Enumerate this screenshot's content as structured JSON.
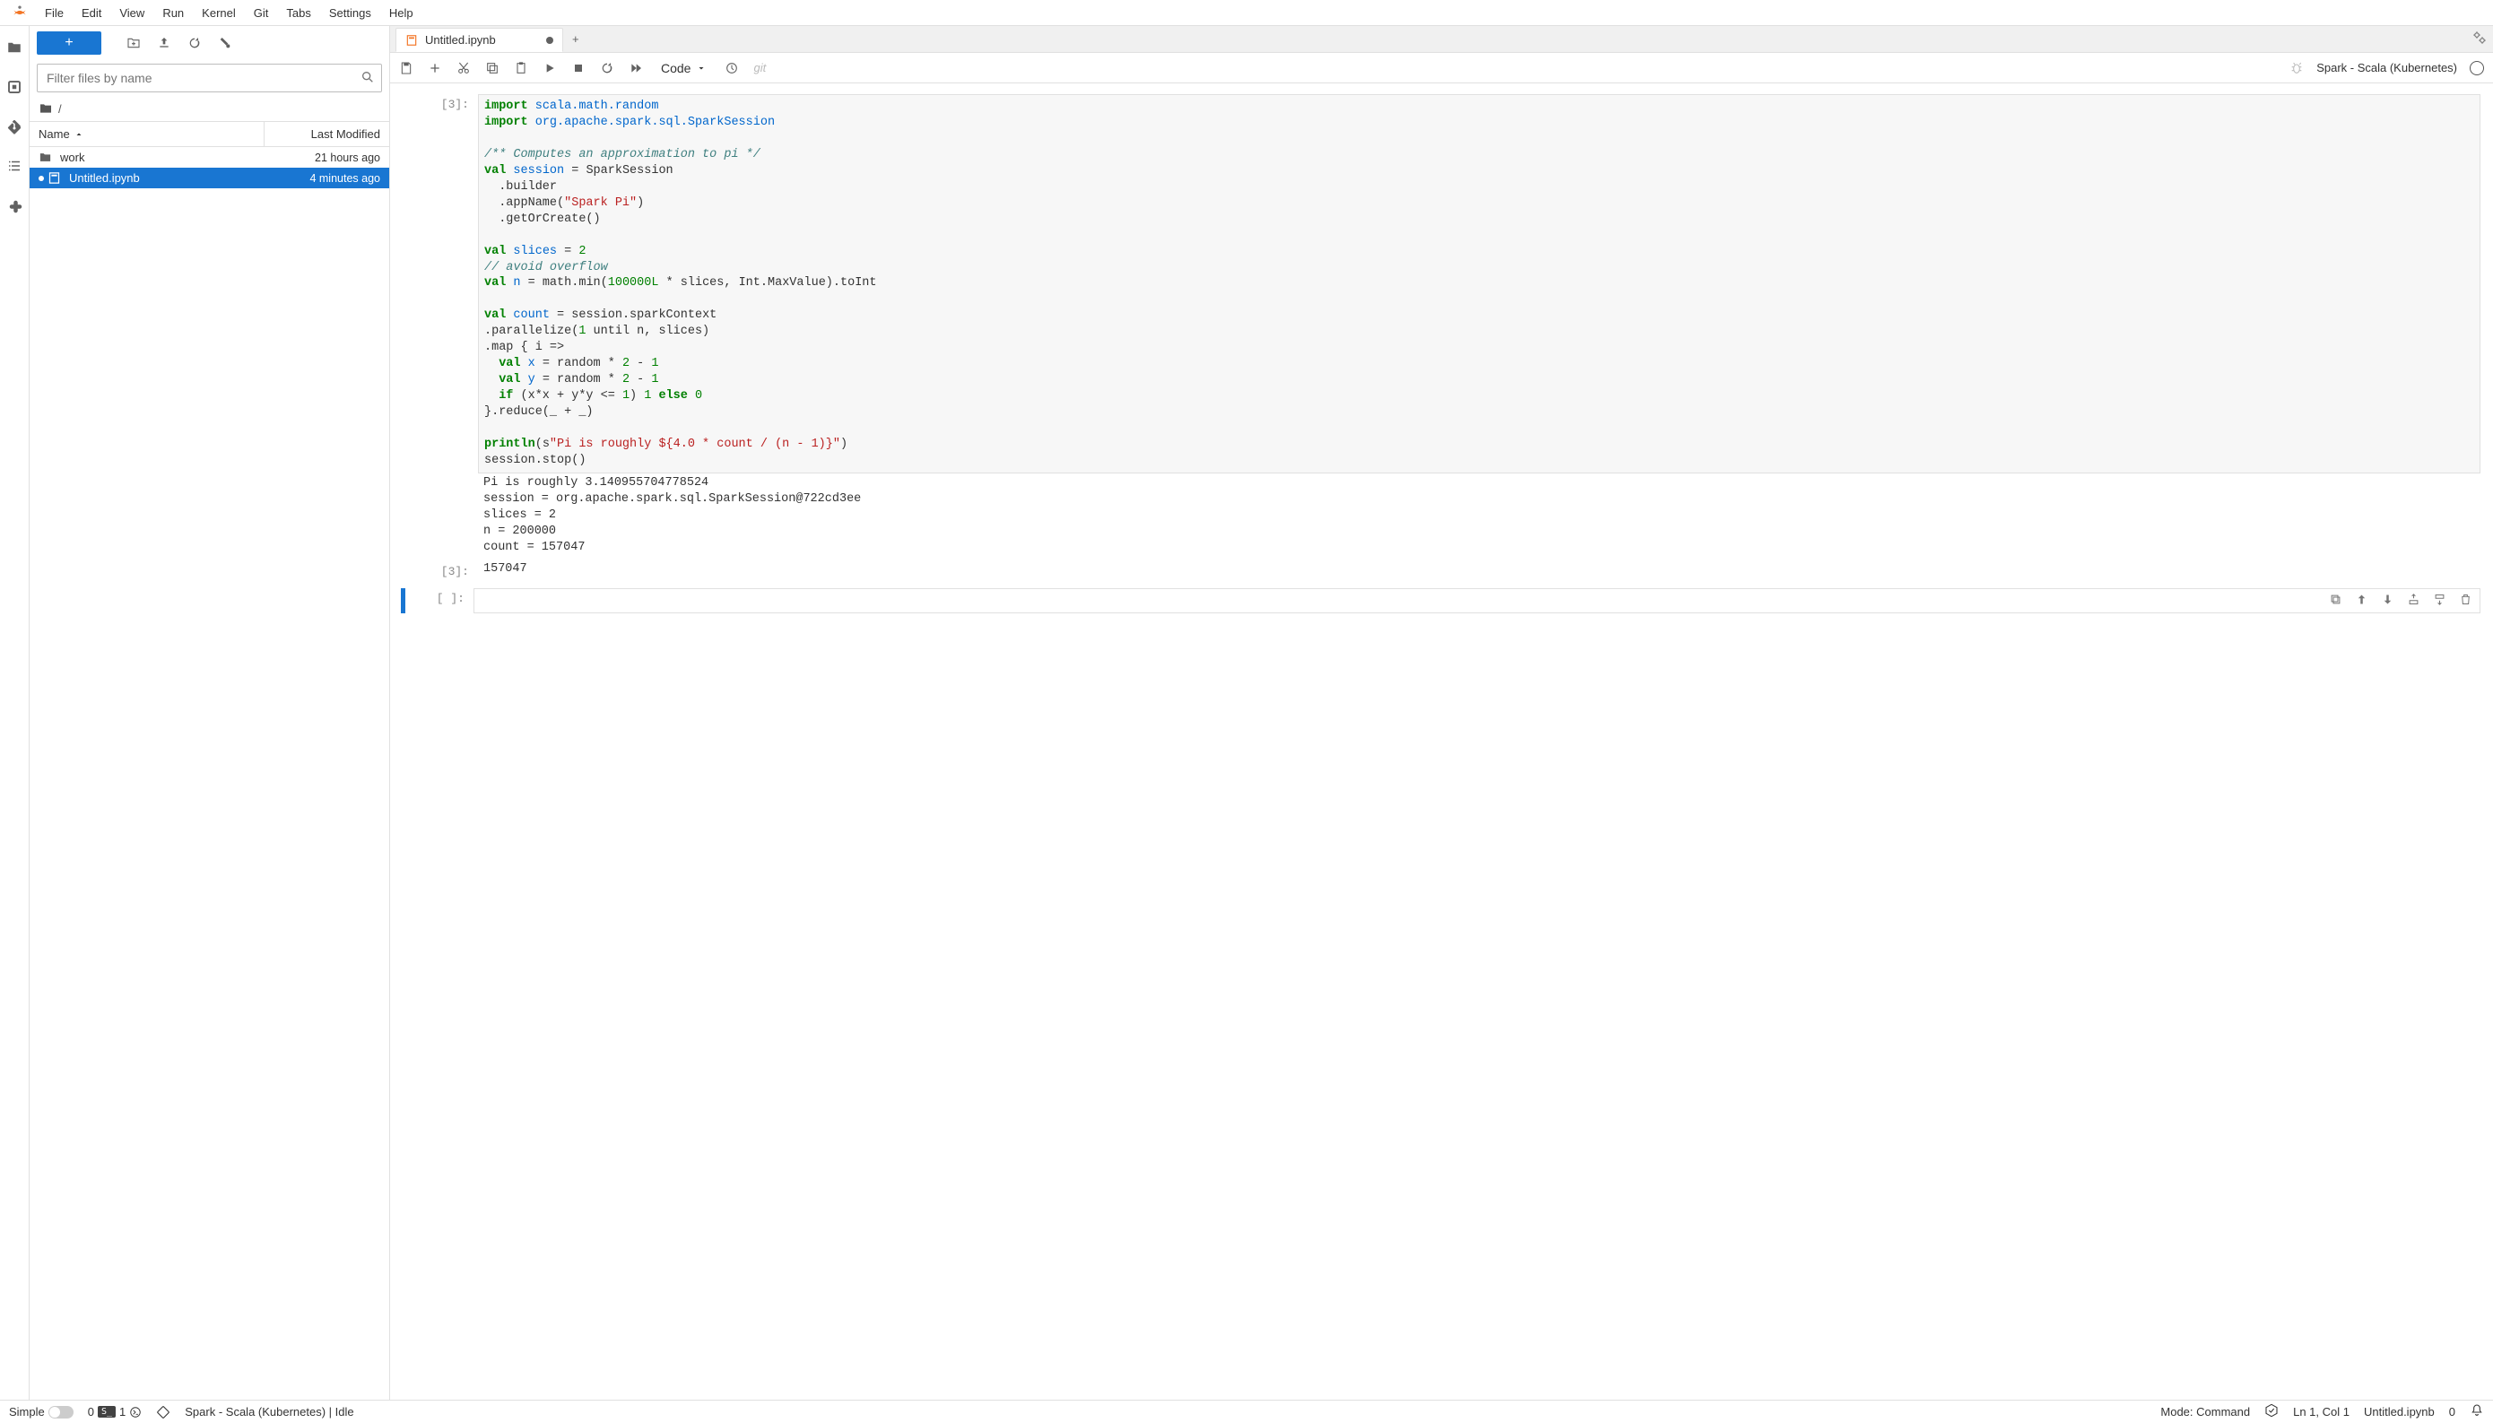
{
  "menubar": [
    "File",
    "Edit",
    "View",
    "Run",
    "Kernel",
    "Git",
    "Tabs",
    "Settings",
    "Help"
  ],
  "filepanel": {
    "filter_placeholder": "Filter files by name",
    "breadcrumb": "/",
    "columns": {
      "name": "Name",
      "modified": "Last Modified"
    },
    "rows": [
      {
        "name": "work",
        "modified": "21 hours ago",
        "type": "folder",
        "selected": false,
        "running": false
      },
      {
        "name": "Untitled.ipynb",
        "modified": "4 minutes ago",
        "type": "notebook",
        "selected": true,
        "running": true
      }
    ]
  },
  "tab": {
    "title": "Untitled.ipynb",
    "dirty": true
  },
  "nb_toolbar": {
    "cell_type": "Code",
    "git_label": "git",
    "kernel_name": "Spark - Scala (Kubernetes)"
  },
  "cells": {
    "c1_prompt": "[3]:",
    "c1_code_html": "<span class='kw'>import</span> <span class='nm'>scala.math.random</span>\n<span class='kw'>import</span> <span class='nm'>org.apache.spark.sql.SparkSession</span>\n\n<span class='cm'>/** Computes an approximation to pi */</span>\n<span class='kw'>val</span> <span class='nm'>session</span> = SparkSession\n  .builder\n  .appName(<span class='st'>\"Spark Pi\"</span>)\n  .getOrCreate()\n\n<span class='kw'>val</span> <span class='nm'>slices</span> = <span class='num'>2</span>\n<span class='cm'>// avoid overflow</span>\n<span class='kw'>val</span> <span class='nm'>n</span> = math.min(<span class='num'>100000L</span> * slices, Int.MaxValue).toInt\n\n<span class='kw'>val</span> <span class='nm'>count</span> = session.sparkContext\n.parallelize(<span class='num'>1</span> until n, slices)\n.map { i =&gt;\n  <span class='kw'>val</span> <span class='nm'>x</span> = random * <span class='num'>2</span> - <span class='num'>1</span>\n  <span class='kw'>val</span> <span class='nm'>y</span> = random * <span class='num'>2</span> - <span class='num'>1</span>\n  <span class='kw'>if</span> (x*x + y*y &lt;= <span class='num'>1</span>) <span class='num'>1</span> <span class='kw'>else</span> <span class='num'>0</span>\n}.reduce(_ + _)\n\n<span class='kw'>println</span>(s<span class='st'>\"Pi is roughly ${4.0 * count / (n - 1)}\"</span>)\nsession.stop()",
    "c1_stdout": "Pi is roughly 3.140955704778524\nsession = org.apache.spark.sql.SparkSession@722cd3ee\nslices = 2\nn = 200000\ncount = 157047",
    "c1_out_prompt": "[3]:",
    "c1_result": "157047",
    "c2_prompt": "[ ]:"
  },
  "statusbar": {
    "simple": "Simple",
    "zero": "0",
    "one": "1",
    "kernel_status": "Spark - Scala (Kubernetes) | Idle",
    "mode": "Mode: Command",
    "cursor": "Ln 1, Col 1",
    "file": "Untitled.ipynb",
    "right_zero": "0"
  }
}
